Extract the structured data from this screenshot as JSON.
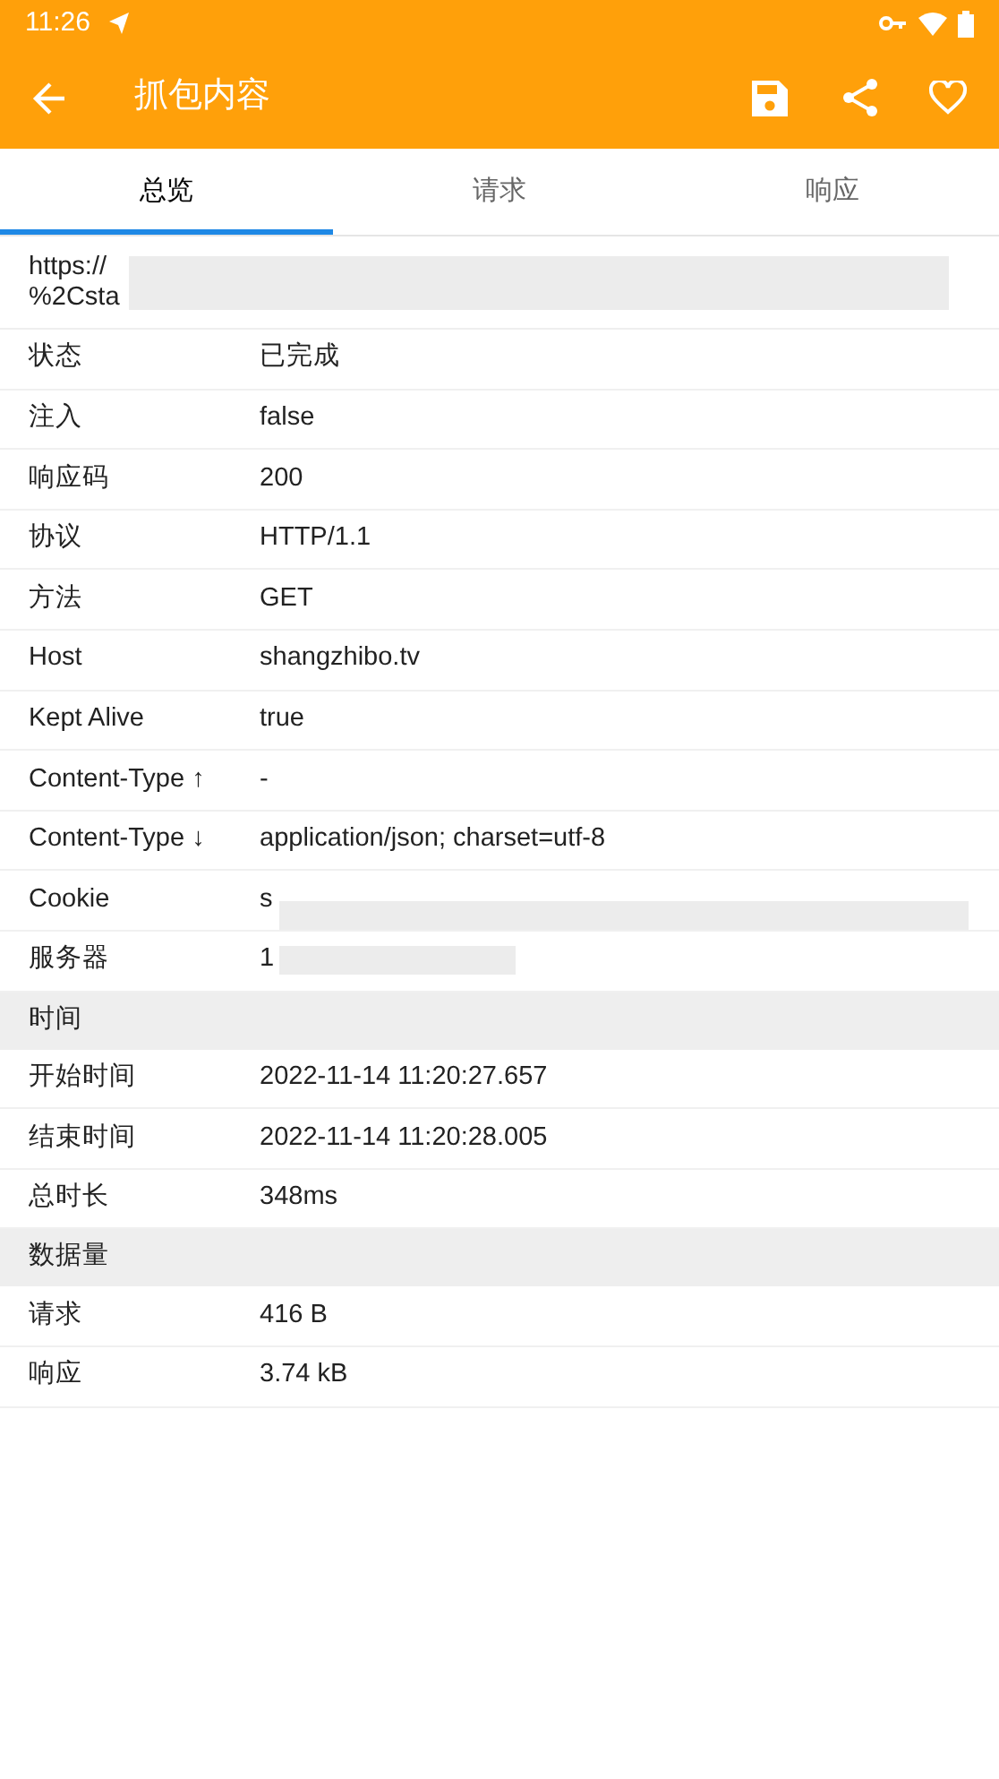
{
  "status_bar": {
    "time": "11:26"
  },
  "app_bar": {
    "title": "抓包内容"
  },
  "tabs": [
    {
      "label": "总览",
      "selected": true
    },
    {
      "label": "请求",
      "selected": false
    },
    {
      "label": "响应",
      "selected": false
    }
  ],
  "url": {
    "lines": [
      "https://",
      "%2Csta"
    ],
    "redacted": true
  },
  "sections": [
    {
      "rows": [
        {
          "label": "状态",
          "value": "已完成",
          "redacted": false
        },
        {
          "label": "注入",
          "value": "false",
          "redacted": false
        },
        {
          "label": "响应码",
          "value": "200",
          "redacted": false
        },
        {
          "label": "协议",
          "value": "HTTP/1.1",
          "redacted": false
        },
        {
          "label": "方法",
          "value": "GET",
          "redacted": false
        },
        {
          "label": "Host",
          "value": "shangzhibo.tv",
          "redacted": false
        },
        {
          "label": "Kept Alive",
          "value": "true",
          "redacted": false
        },
        {
          "label": "Content-Type ↑",
          "value": "-",
          "redacted": false
        },
        {
          "label": "Content-Type ↓",
          "value": "application/json; charset=utf-8",
          "redacted": false
        },
        {
          "label": "Cookie",
          "value": "s",
          "redacted": true
        },
        {
          "label": "服务器",
          "value": "1",
          "redacted": true
        }
      ]
    },
    {
      "title": "时间",
      "rows": [
        {
          "label": "开始时间",
          "value": "2022-11-14 11:20:27.657",
          "redacted": false
        },
        {
          "label": "结束时间",
          "value": "2022-11-14 11:20:28.005",
          "redacted": false
        },
        {
          "label": "总时长",
          "value": "348ms",
          "redacted": false
        }
      ]
    },
    {
      "title": "数据量",
      "rows": [
        {
          "label": "请求",
          "value": "416 B",
          "redacted": false
        },
        {
          "label": "响应",
          "value": "3.74 kB",
          "redacted": false
        }
      ]
    }
  ]
}
